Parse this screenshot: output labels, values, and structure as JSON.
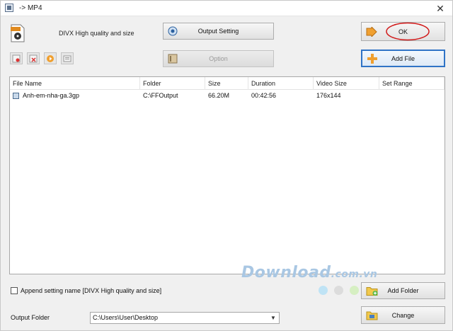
{
  "window": {
    "title": "-> MP4",
    "close_glyph": "✕"
  },
  "profile": {
    "name": "DIVX High quality and size",
    "icon": "mp4-file-icon"
  },
  "buttons": {
    "output_setting": "Output Setting",
    "option": "Option",
    "ok": "OK",
    "add_file": "Add File",
    "add_folder": "Add Folder",
    "change": "Change"
  },
  "toolbar": {
    "tools": [
      "remove-icon",
      "delete-icon",
      "play-icon",
      "info-icon"
    ]
  },
  "list": {
    "columns": [
      "File Name",
      "Folder",
      "Size",
      "Duration",
      "Video Size",
      "Set Range"
    ],
    "rows": [
      {
        "file_name": "Anh-em-nha-ga.3gp",
        "folder": "C:\\FFOutput",
        "size": "66.20M",
        "duration": "00:42:56",
        "video_size": "176x144",
        "set_range": ""
      }
    ]
  },
  "watermark": {
    "main": "Download",
    "suffix": ".com.vn"
  },
  "append_setting": {
    "label": "Append setting name [DIVX High quality and size]",
    "checked": false
  },
  "output_folder": {
    "label": "Output Folder",
    "value": "C:\\Users\\User\\Desktop"
  },
  "colors": {
    "accent": "#2f73c6",
    "highlight_circle": "#d11a1a",
    "ok_arrow": "#f0a030"
  }
}
